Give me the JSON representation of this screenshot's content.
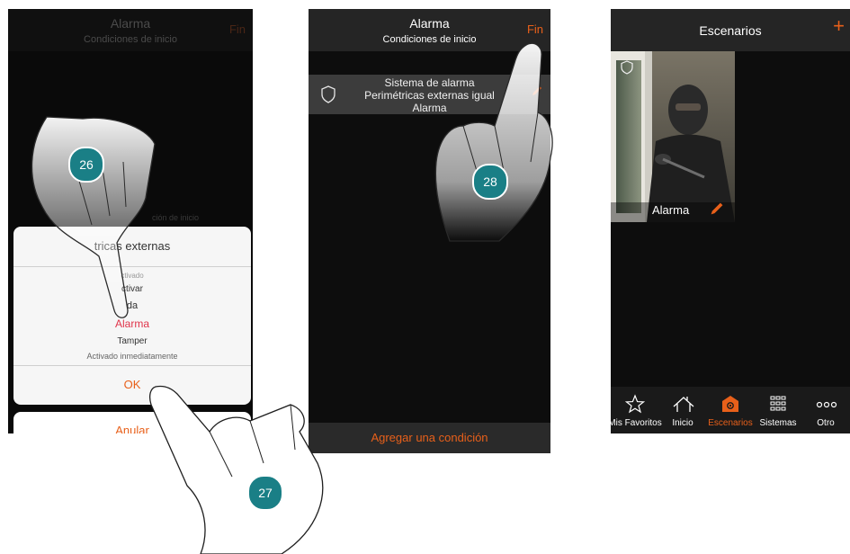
{
  "screen1": {
    "header": {
      "title": "Alarma",
      "subtitle": "Condiciones de inicio",
      "fin": "Fin"
    },
    "background_hint": "ción de inicio",
    "dialog": {
      "title": "tricas externas",
      "options": [
        "ctivado",
        "ctivar",
        "da",
        "Alarma",
        "Tamper",
        "Activado inmediatamente"
      ],
      "selected": "Alarma",
      "ok": "OK"
    },
    "cancel": "Anular"
  },
  "screen2": {
    "header": {
      "title": "Alarma",
      "subtitle": "Condiciones de inicio",
      "fin": "Fin"
    },
    "condition": {
      "line1": "Sistema de alarma",
      "line2": "Perimétricas externas igual",
      "line3": "Alarma"
    },
    "footer": "Agregar una condición"
  },
  "screen3": {
    "header": {
      "title": "Escenarios",
      "add": "+"
    },
    "tile": {
      "label": "Alarma"
    },
    "tabs": [
      {
        "label": "Mis Favoritos",
        "icon": "star-icon"
      },
      {
        "label": "Inicio",
        "icon": "home-icon"
      },
      {
        "label": "Escenarios",
        "icon": "scenario-icon"
      },
      {
        "label": "Sistemas",
        "icon": "grid-icon"
      },
      {
        "label": "Otro",
        "icon": "more-icon"
      }
    ],
    "active_tab": "Escenarios"
  },
  "steps": [
    "26",
    "27",
    "28"
  ],
  "colors": {
    "accent": "#e8601a",
    "selected": "#e0344a",
    "badge": "#1a7f86"
  }
}
